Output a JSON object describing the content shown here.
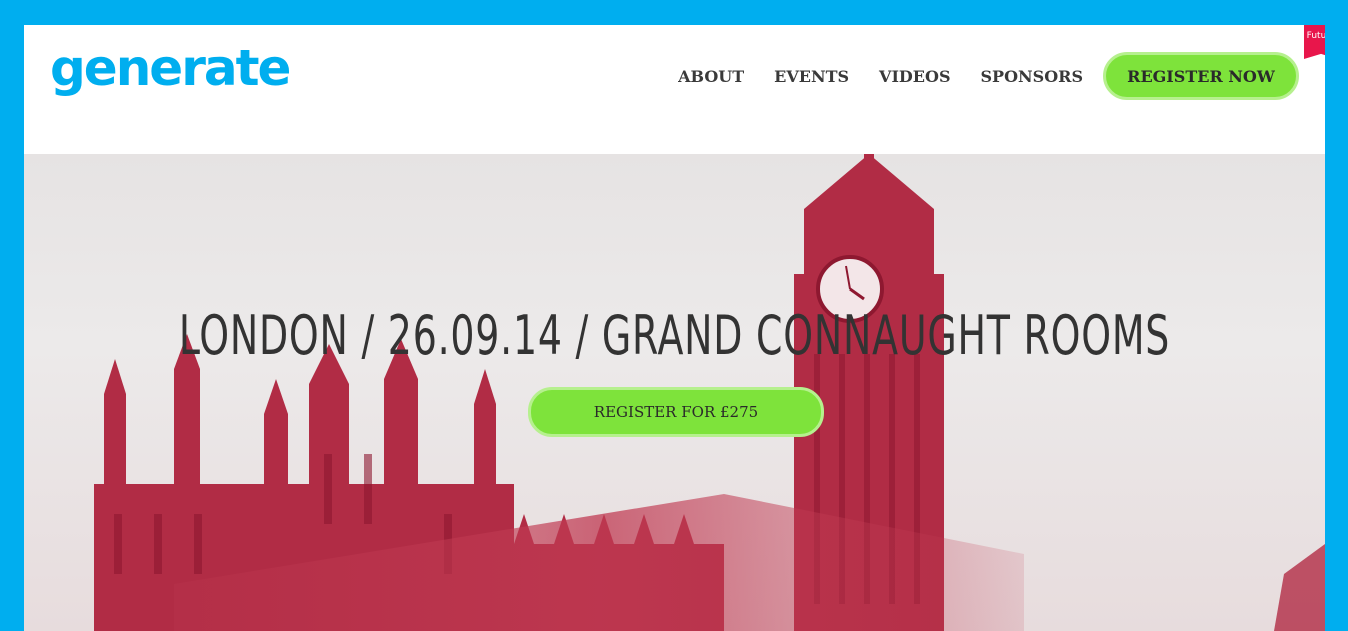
{
  "brand": {
    "logo_text": "generate",
    "publisher_tag": "Future",
    "colors": {
      "frame": "#00aeef",
      "cta": "#7ee33b",
      "tag": "#e8164b",
      "hero_tint": "#b01e3c"
    }
  },
  "nav": {
    "items": [
      {
        "label": "ABOUT"
      },
      {
        "label": "EVENTS"
      },
      {
        "label": "VIDEOS"
      },
      {
        "label": "SPONSORS"
      }
    ],
    "cta_label": "REGISTER NOW"
  },
  "hero": {
    "title": "LONDON / 26.09.14 / GRAND CONNAUGHT ROOMS",
    "cta_label": "REGISTER FOR £275"
  }
}
